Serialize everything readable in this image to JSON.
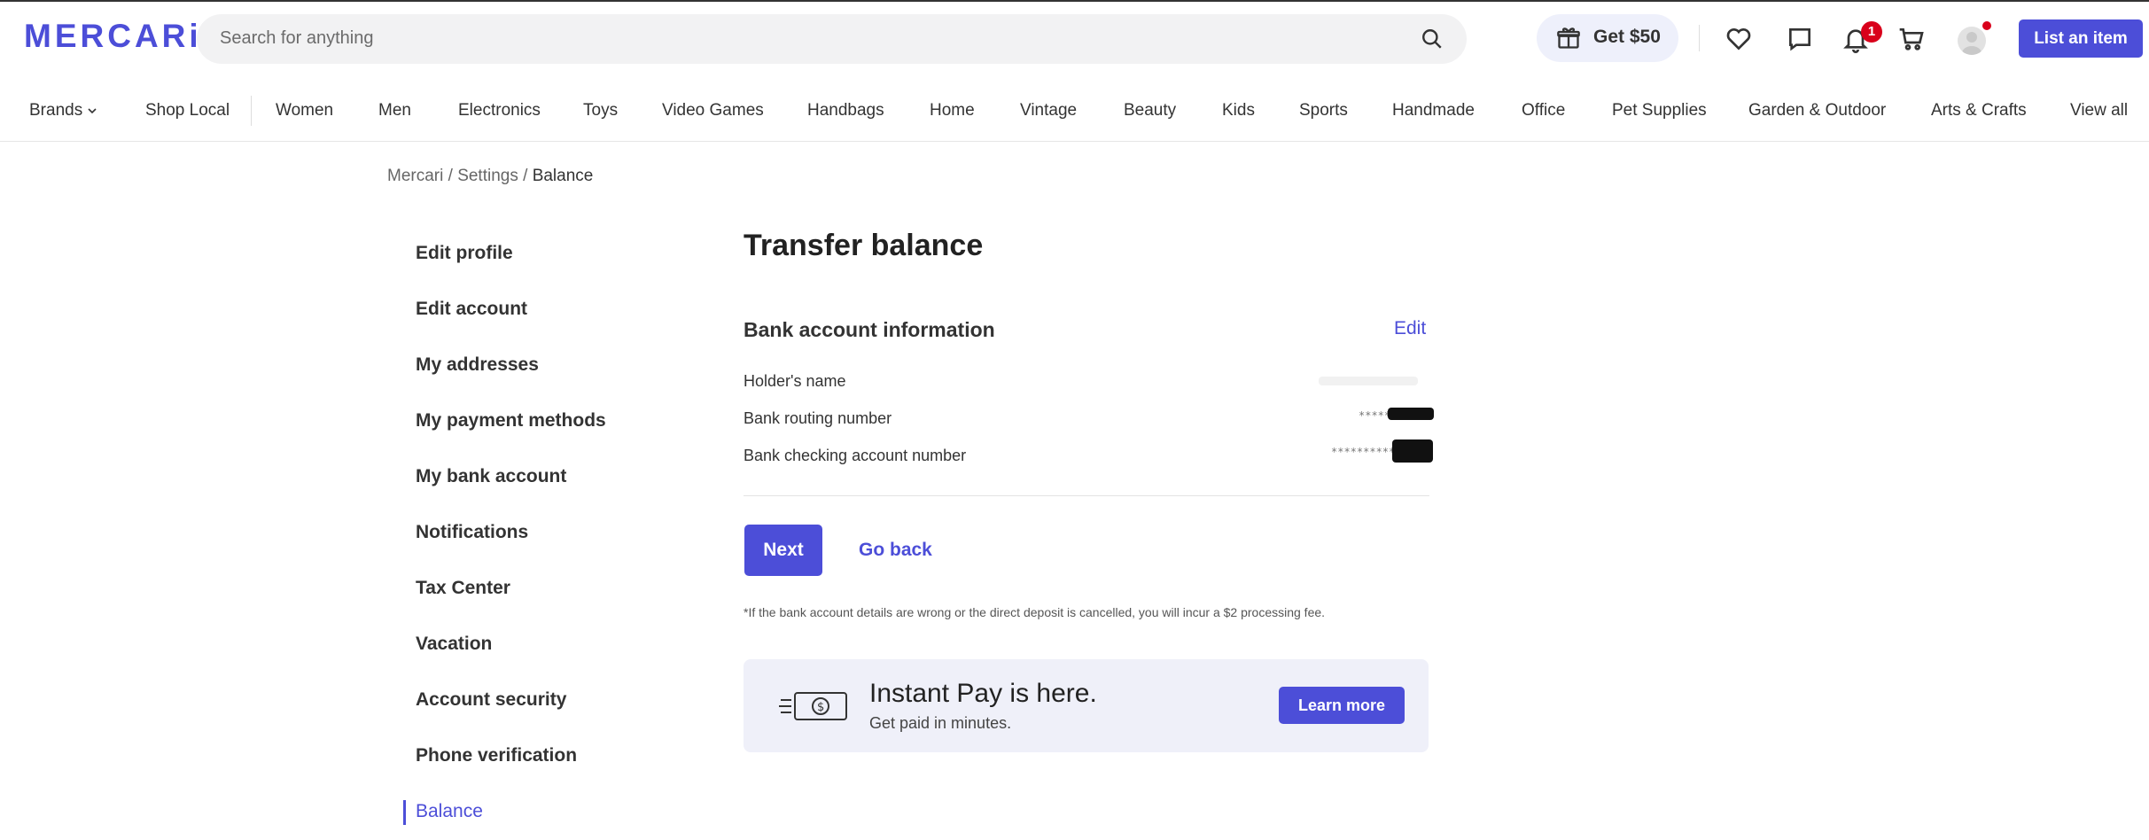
{
  "header": {
    "logo": "MERCARi",
    "search_placeholder": "Search for anything",
    "gift_label": "Get $50",
    "notification_count": "1",
    "list_item_label": "List an item"
  },
  "categories": {
    "brands": "Brands",
    "items": [
      "Shop Local",
      "Women",
      "Men",
      "Electronics",
      "Toys",
      "Video Games",
      "Handbags",
      "Home",
      "Vintage",
      "Beauty",
      "Kids",
      "Sports",
      "Handmade",
      "Office",
      "Pet Supplies",
      "Garden & Outdoor",
      "Arts & Crafts",
      "View all"
    ]
  },
  "breadcrumb": {
    "root": "Mercari",
    "sep": "/",
    "settings": "Settings",
    "current": "Balance"
  },
  "sidenav": {
    "items": [
      "Edit profile",
      "Edit account",
      "My addresses",
      "My payment methods",
      "My bank account",
      "Notifications",
      "Tax Center",
      "Vacation",
      "Account security",
      "Phone verification",
      "Balance"
    ],
    "active": "Balance"
  },
  "main": {
    "title": "Transfer balance",
    "section_title": "Bank account information",
    "edit_label": "Edit",
    "rows": [
      {
        "label": "Holder's name",
        "value": ""
      },
      {
        "label": "Bank routing number",
        "value": "*****"
      },
      {
        "label": "Bank checking account number",
        "value": "**********"
      }
    ],
    "next_label": "Next",
    "go_back_label": "Go back",
    "disclaimer": "*If the bank account details are wrong or the direct deposit is cancelled, you will incur a $2 processing fee."
  },
  "banner": {
    "title": "Instant Pay is here.",
    "subtitle": "Get paid in minutes.",
    "button": "Learn more"
  },
  "colors": {
    "brand": "#4c4ed8",
    "badge": "#d9001b",
    "banner_bg": "#eff0f9"
  }
}
